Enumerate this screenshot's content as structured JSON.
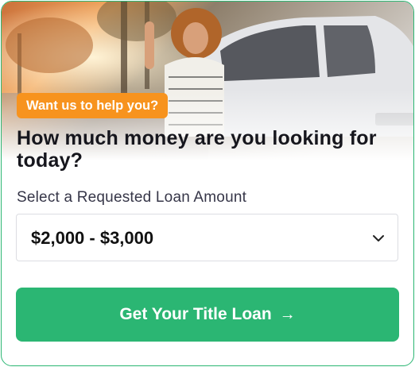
{
  "promo": {
    "badge": "Want us to help you?",
    "heading": "How much money are you looking for today?"
  },
  "loan_select": {
    "label": "Select a Requested Loan Amount",
    "selected": "$2,000 - $3,000",
    "chevron_icon": "chevron-down-icon"
  },
  "cta": {
    "label": "Get Your Title Loan",
    "arrow": "→"
  },
  "colors": {
    "brand_green": "#2bb673",
    "badge_orange": "#f7931e"
  }
}
